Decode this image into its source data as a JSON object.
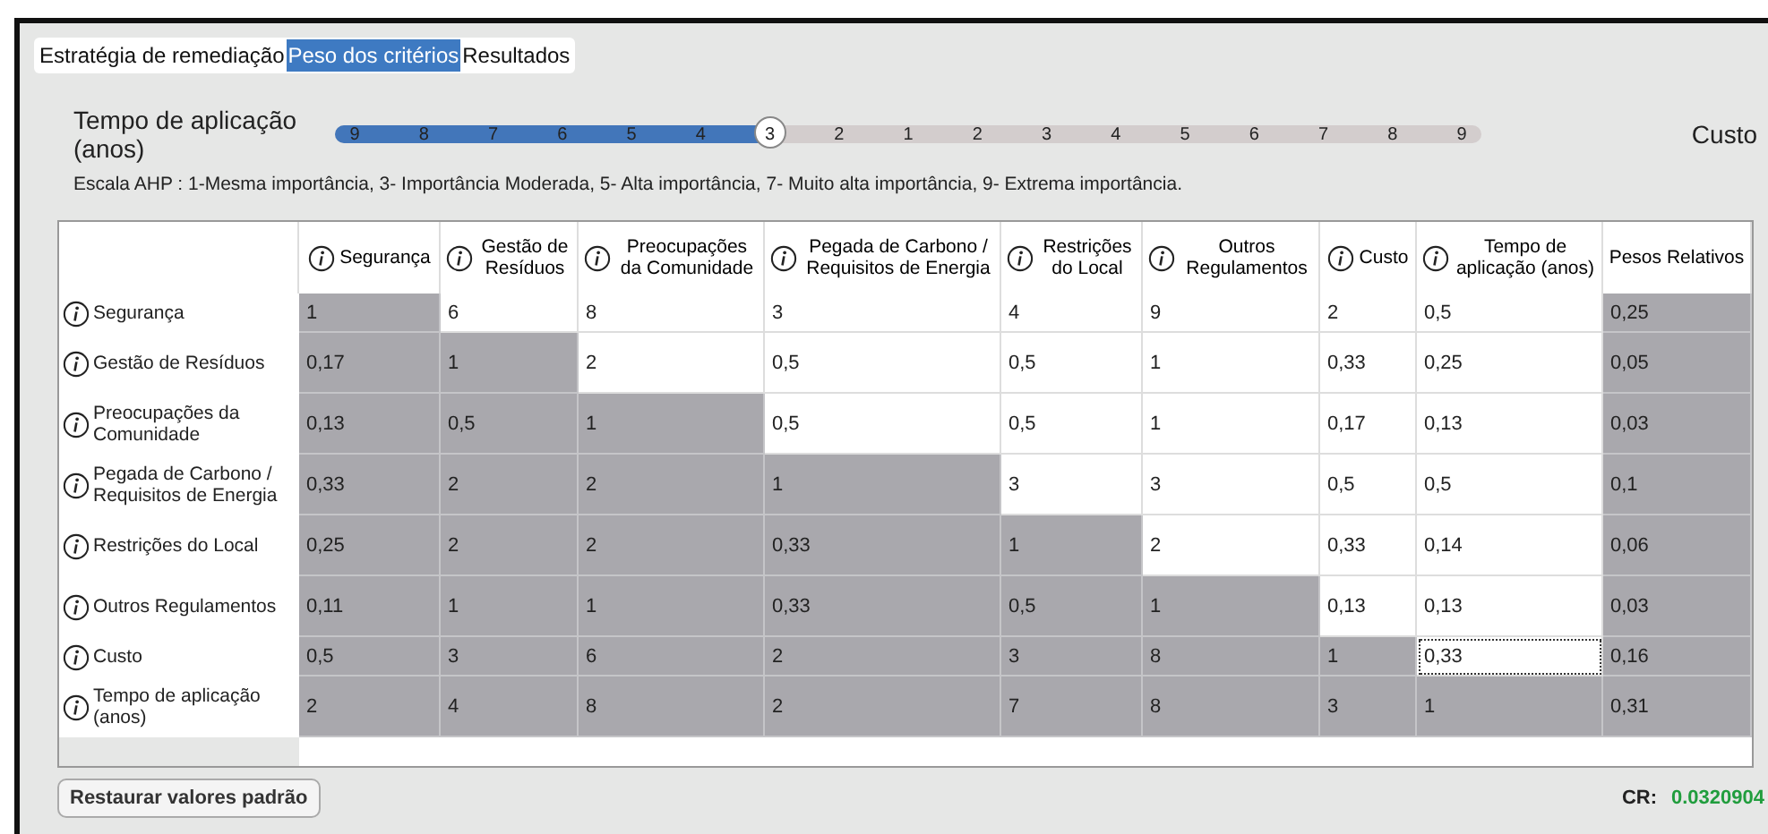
{
  "tabs": [
    {
      "label": "Estratégia de remediação",
      "selected": false
    },
    {
      "label": "Peso dos critérios",
      "selected": true
    },
    {
      "label": "Resultados",
      "selected": false
    }
  ],
  "comparison": {
    "left_label": "Tempo de aplicação (anos)",
    "right_label": "Custo",
    "level": 0.375,
    "ticks": [
      "9",
      "8",
      "7",
      "6",
      "5",
      "4",
      "3",
      "2",
      "1",
      "2",
      "3",
      "4",
      "5",
      "6",
      "7",
      "8",
      "9"
    ]
  },
  "scale_note": "Escala AHP : 1-Mesma importância, 3- Importância Moderada, 5- Alta importância, 7- Muito alta importância, 9- Extrema importância.",
  "table": {
    "columns": [
      "Segurança",
      "Gestão de Resíduos",
      "Preocupações da Comunidade",
      "Pegada de Carbono / Requisitos de Energia",
      "Restrições do Local",
      "Outros Regulamentos",
      "Custo",
      "Tempo de aplicação (anos)"
    ],
    "weights_header": "Pesos Relativos",
    "rows": [
      {
        "label": "Segurança",
        "cells": [
          {
            "value": "1",
            "editable": false,
            "selected": false
          },
          {
            "value": "6",
            "editable": true,
            "selected": false
          },
          {
            "value": "8",
            "editable": true,
            "selected": false
          },
          {
            "value": "3",
            "editable": true,
            "selected": false
          },
          {
            "value": "4",
            "editable": true,
            "selected": false
          },
          {
            "value": "9",
            "editable": true,
            "selected": false
          },
          {
            "value": "2",
            "editable": true,
            "selected": false
          },
          {
            "value": "0,5",
            "editable": true,
            "selected": false
          }
        ],
        "weight": "0,25"
      },
      {
        "label": "Gestão de Resíduos",
        "cells": [
          {
            "value": "0,17",
            "editable": false,
            "selected": false
          },
          {
            "value": "1",
            "editable": false,
            "selected": false
          },
          {
            "value": "2",
            "editable": true,
            "selected": false
          },
          {
            "value": "0,5",
            "editable": true,
            "selected": false
          },
          {
            "value": "0,5",
            "editable": true,
            "selected": false
          },
          {
            "value": "1",
            "editable": true,
            "selected": false
          },
          {
            "value": "0,33",
            "editable": true,
            "selected": false
          },
          {
            "value": "0,25",
            "editable": true,
            "selected": false
          }
        ],
        "weight": "0,05"
      },
      {
        "label": "Preocupações da Comunidade",
        "cells": [
          {
            "value": "0,13",
            "editable": false,
            "selected": false
          },
          {
            "value": "0,5",
            "editable": false,
            "selected": false
          },
          {
            "value": "1",
            "editable": false,
            "selected": false
          },
          {
            "value": "0,5",
            "editable": true,
            "selected": false
          },
          {
            "value": "0,5",
            "editable": true,
            "selected": false
          },
          {
            "value": "1",
            "editable": true,
            "selected": false
          },
          {
            "value": "0,17",
            "editable": true,
            "selected": false
          },
          {
            "value": "0,13",
            "editable": true,
            "selected": false
          }
        ],
        "weight": "0,03"
      },
      {
        "label": "Pegada de Carbono / Requisitos de Energia",
        "cells": [
          {
            "value": "0,33",
            "editable": false,
            "selected": false
          },
          {
            "value": "2",
            "editable": false,
            "selected": false
          },
          {
            "value": "2",
            "editable": false,
            "selected": false
          },
          {
            "value": "1",
            "editable": false,
            "selected": false
          },
          {
            "value": "3",
            "editable": true,
            "selected": false
          },
          {
            "value": "3",
            "editable": true,
            "selected": false
          },
          {
            "value": "0,5",
            "editable": true,
            "selected": false
          },
          {
            "value": "0,5",
            "editable": true,
            "selected": false
          }
        ],
        "weight": "0,1"
      },
      {
        "label": "Restrições do Local",
        "cells": [
          {
            "value": "0,25",
            "editable": false,
            "selected": false
          },
          {
            "value": "2",
            "editable": false,
            "selected": false
          },
          {
            "value": "2",
            "editable": false,
            "selected": false
          },
          {
            "value": "0,33",
            "editable": false,
            "selected": false
          },
          {
            "value": "1",
            "editable": false,
            "selected": false
          },
          {
            "value": "2",
            "editable": true,
            "selected": false
          },
          {
            "value": "0,33",
            "editable": true,
            "selected": false
          },
          {
            "value": "0,14",
            "editable": true,
            "selected": false
          }
        ],
        "weight": "0,06"
      },
      {
        "label": "Outros Regulamentos",
        "cells": [
          {
            "value": "0,11",
            "editable": false,
            "selected": false
          },
          {
            "value": "1",
            "editable": false,
            "selected": false
          },
          {
            "value": "1",
            "editable": false,
            "selected": false
          },
          {
            "value": "0,33",
            "editable": false,
            "selected": false
          },
          {
            "value": "0,5",
            "editable": false,
            "selected": false
          },
          {
            "value": "1",
            "editable": false,
            "selected": false
          },
          {
            "value": "0,13",
            "editable": true,
            "selected": false
          },
          {
            "value": "0,13",
            "editable": true,
            "selected": false
          }
        ],
        "weight": "0,03"
      },
      {
        "label": "Custo",
        "cells": [
          {
            "value": "0,5",
            "editable": false,
            "selected": false
          },
          {
            "value": "3",
            "editable": false,
            "selected": false
          },
          {
            "value": "6",
            "editable": false,
            "selected": false
          },
          {
            "value": "2",
            "editable": false,
            "selected": false
          },
          {
            "value": "3",
            "editable": false,
            "selected": false
          },
          {
            "value": "8",
            "editable": false,
            "selected": false
          },
          {
            "value": "1",
            "editable": false,
            "selected": false
          },
          {
            "value": "0,33",
            "editable": true,
            "selected": true
          }
        ],
        "weight": "0,16"
      },
      {
        "label": "Tempo de aplicação (anos)",
        "cells": [
          {
            "value": "2",
            "editable": false,
            "selected": false
          },
          {
            "value": "4",
            "editable": false,
            "selected": false
          },
          {
            "value": "8",
            "editable": false,
            "selected": false
          },
          {
            "value": "2",
            "editable": false,
            "selected": false
          },
          {
            "value": "7",
            "editable": false,
            "selected": false
          },
          {
            "value": "8",
            "editable": false,
            "selected": false
          },
          {
            "value": "3",
            "editable": false,
            "selected": false
          },
          {
            "value": "1",
            "editable": false,
            "selected": false
          }
        ],
        "weight": "0,31"
      }
    ]
  },
  "reset_button": "Restaurar valores padrão",
  "cr": {
    "label": "CR:",
    "value": "0.0320904"
  }
}
